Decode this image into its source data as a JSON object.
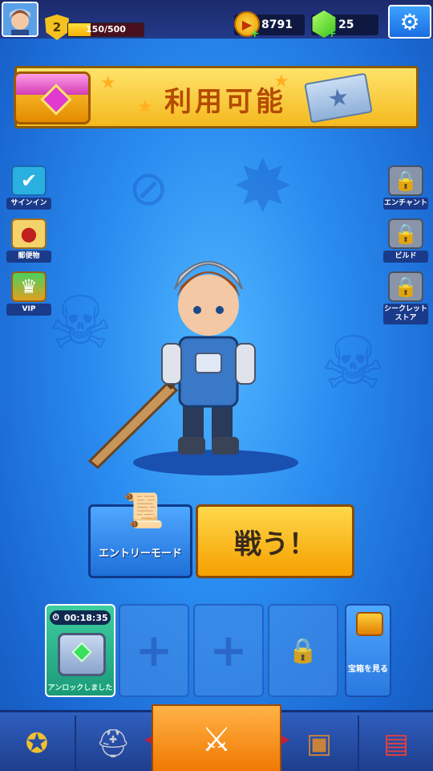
{
  "player": {
    "level": "2",
    "xp_text": "150/500",
    "xp_fraction": 0.3
  },
  "currency": {
    "coins": "8791",
    "gems": "25"
  },
  "banner": {
    "title": "利用可能"
  },
  "left_menu": [
    {
      "label": "サインイン",
      "icon": "calendar-check-icon"
    },
    {
      "label": "郵便物",
      "icon": "mail-icon"
    },
    {
      "label": "VIP",
      "icon": "vip-crown-icon"
    }
  ],
  "right_menu": [
    {
      "label": "エンチャント",
      "icon": "anvil-icon"
    },
    {
      "label": "ビルド",
      "icon": "build-icon"
    },
    {
      "label": "シークレットストア",
      "icon": "secret-store-icon"
    }
  ],
  "actions": {
    "entry_mode": "エントリーモード",
    "fight": "戦う！"
  },
  "chest_slots": {
    "active": {
      "timer": "00:18:35",
      "status": "アンロックしました"
    },
    "view_chests": "宝箱を見る"
  },
  "bottom_nav": [
    {
      "icon": "rank-medal-icon"
    },
    {
      "icon": "helmet-icon"
    },
    {
      "icon": "crossed-swords-icon",
      "active": true
    },
    {
      "icon": "backpack-icon"
    },
    {
      "icon": "treasure-chest-icon"
    }
  ],
  "colors": {
    "background": "#2a8cf0",
    "fight_button": "#f5a000",
    "entry_button": "#1f6fd8",
    "active_nav": "#f07800"
  }
}
